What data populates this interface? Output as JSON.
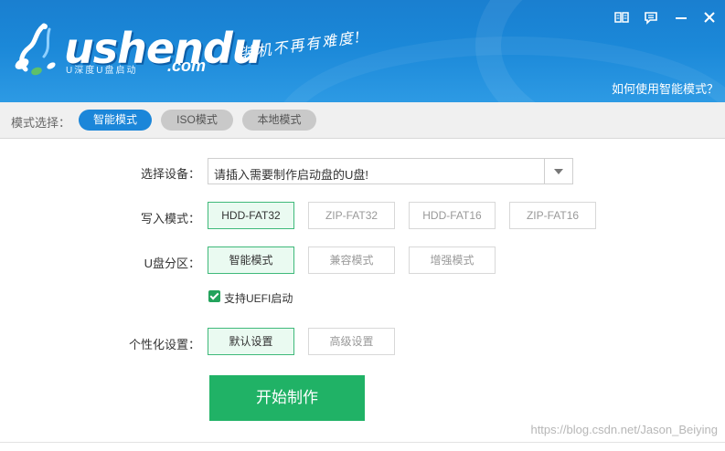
{
  "header": {
    "brand": {
      "wordmark": "ushendu",
      "domain": ".com",
      "subtitle": "U深度U盘启动"
    },
    "slogan": "装机不再有难度!",
    "help_link": "如何使用智能模式？",
    "window_controls": [
      "book-icon",
      "chat-icon",
      "minimize-icon",
      "close-icon"
    ]
  },
  "modebar": {
    "label": "模式选择：",
    "modes": [
      {
        "label": "智能模式",
        "active": true
      },
      {
        "label": "ISO模式",
        "active": false
      },
      {
        "label": "本地模式",
        "active": false
      }
    ]
  },
  "form": {
    "device": {
      "label": "选择设备：",
      "value": "请插入需要制作启动盘的U盘!"
    },
    "write_mode": {
      "label": "写入模式：",
      "options": [
        {
          "label": "HDD-FAT32",
          "selected": true
        },
        {
          "label": "ZIP-FAT32",
          "selected": false
        },
        {
          "label": "HDD-FAT16",
          "selected": false
        },
        {
          "label": "ZIP-FAT16",
          "selected": false
        }
      ]
    },
    "partition": {
      "label": "U盘分区：",
      "options": [
        {
          "label": "智能模式",
          "selected": true
        },
        {
          "label": "兼容模式",
          "selected": false
        },
        {
          "label": "增强模式",
          "selected": false
        }
      ]
    },
    "uefi": {
      "label": "支持UEFI启动",
      "checked": true
    },
    "personalize": {
      "label": "个性化设置：",
      "options": [
        {
          "label": "默认设置",
          "selected": true
        },
        {
          "label": "高级设置",
          "selected": false
        }
      ]
    },
    "start_button": "开始制作"
  },
  "watermark": "https://blog.csdn.net/Jason_Beiying",
  "colors": {
    "header_blue": "#1b88d8",
    "mode_active": "#1b86d9",
    "option_selected_border": "#3fb97a",
    "start_green": "#20b266"
  }
}
